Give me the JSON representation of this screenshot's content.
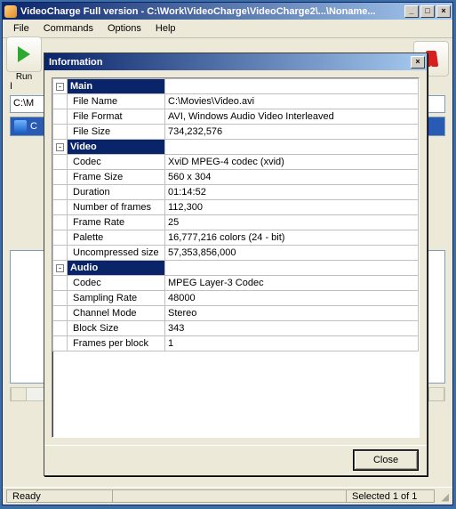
{
  "outer": {
    "title": "VideoCharge Full version - C:\\Work\\VideoCharge\\VideoCharge2\\...\\Noname...",
    "menu": [
      "File",
      "Commands",
      "Options",
      "Help"
    ],
    "run_label": "Run",
    "tab_prefix": "I",
    "path_prefix": "C:\\M",
    "file_prefix": "C"
  },
  "dialog": {
    "title": "Information",
    "close_label": "Close",
    "sections": [
      {
        "name": "Main",
        "rows": [
          {
            "k": "File Name",
            "v": "C:\\Movies\\Video.avi"
          },
          {
            "k": "File Format",
            "v": "AVI, Windows Audio Video Interleaved"
          },
          {
            "k": "File Size",
            "v": "734,232,576"
          }
        ]
      },
      {
        "name": "Video",
        "rows": [
          {
            "k": "Codec",
            "v": "XviD MPEG-4 codec (xvid)"
          },
          {
            "k": "Frame Size",
            "v": "560 x 304"
          },
          {
            "k": "Duration",
            "v": "01:14:52"
          },
          {
            "k": "Number of frames",
            "v": "112,300"
          },
          {
            "k": "Frame Rate",
            "v": "25"
          },
          {
            "k": "Palette",
            "v": "16,777,216 colors (24 - bit)"
          },
          {
            "k": "Uncompressed size",
            "v": "57,353,856,000"
          }
        ]
      },
      {
        "name": "Audio",
        "rows": [
          {
            "k": "Codec",
            "v": "MPEG Layer-3 Codec"
          },
          {
            "k": "Sampling Rate",
            "v": "48000"
          },
          {
            "k": "Channel Mode",
            "v": "Stereo"
          },
          {
            "k": "Block Size",
            "v": "343"
          },
          {
            "k": "Frames per block",
            "v": "1"
          }
        ]
      }
    ]
  },
  "status": {
    "ready": "Ready",
    "selected": "Selected 1 of 1"
  }
}
